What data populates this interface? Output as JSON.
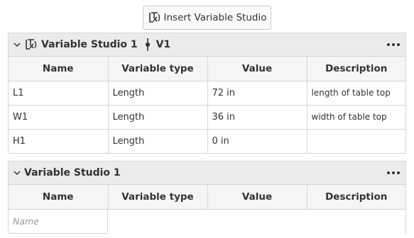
{
  "insert_button": {
    "label": "Insert Variable Studio"
  },
  "panels": [
    {
      "title": "Variable Studio 1",
      "version": "V1",
      "columns": [
        "Name",
        "Variable type",
        "Value",
        "Description"
      ],
      "rows": [
        {
          "name": "L1",
          "type": "Length",
          "value": "72 in",
          "description": "length of table top"
        },
        {
          "name": "W1",
          "type": "Length",
          "value": "36 in",
          "description": "width of table top"
        },
        {
          "name": "H1",
          "type": "Length",
          "value": "0 in",
          "description": ""
        }
      ]
    },
    {
      "title": "Variable Studio 1",
      "columns": [
        "Name",
        "Variable type",
        "Value",
        "Description"
      ],
      "name_placeholder": "Name"
    }
  ]
}
